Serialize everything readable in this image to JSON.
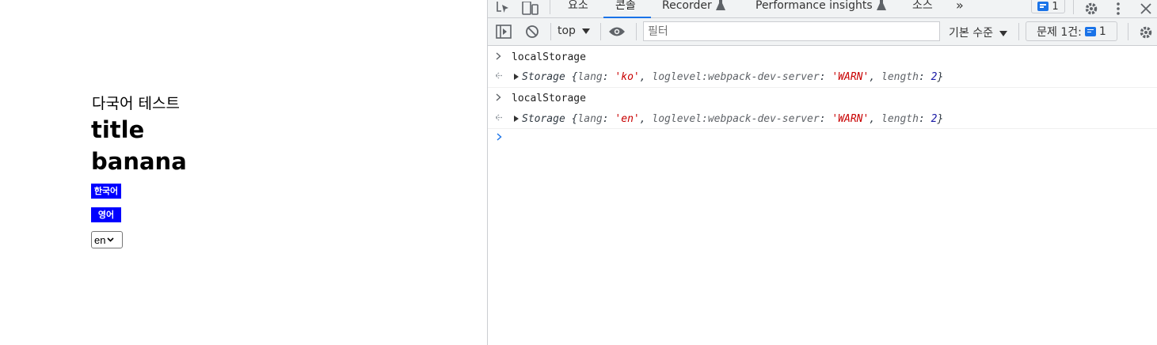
{
  "page": {
    "heading": "다국어 테스트",
    "title_text": "title",
    "fruit_text": "banana",
    "buttons": {
      "korean": "한국어",
      "english": "영어"
    },
    "language_select": {
      "value": "en"
    }
  },
  "devtools": {
    "tabs": [
      {
        "label": "요소"
      },
      {
        "label": "콘솔",
        "active": true
      },
      {
        "label": "Recorder"
      },
      {
        "label": "Performance insights"
      },
      {
        "label": "소스"
      }
    ],
    "more_tabs_glyph": "»",
    "issues_chip_count": "1",
    "toolbar": {
      "context": "top",
      "filter_placeholder": "필터",
      "log_level": "기본 수준",
      "issues_label": "문제 1건:",
      "issues_count": "1"
    },
    "console": {
      "entries": [
        {
          "command": "localStorage",
          "result": {
            "prefix": "Storage {",
            "lang_key": "lang",
            "lang_value": "'ko'",
            "loglevel_key": "loglevel:webpack-dev-server",
            "loglevel_value": "'WARN'",
            "length_key": "length",
            "length_value": "2",
            "suffix": "}"
          }
        },
        {
          "command": "localStorage",
          "result": {
            "prefix": "Storage {",
            "lang_key": "lang",
            "lang_value": "'en'",
            "loglevel_key": "loglevel:webpack-dev-server",
            "loglevel_value": "'WARN'",
            "length_key": "length",
            "length_value": "2",
            "suffix": "}"
          }
        }
      ]
    }
  }
}
